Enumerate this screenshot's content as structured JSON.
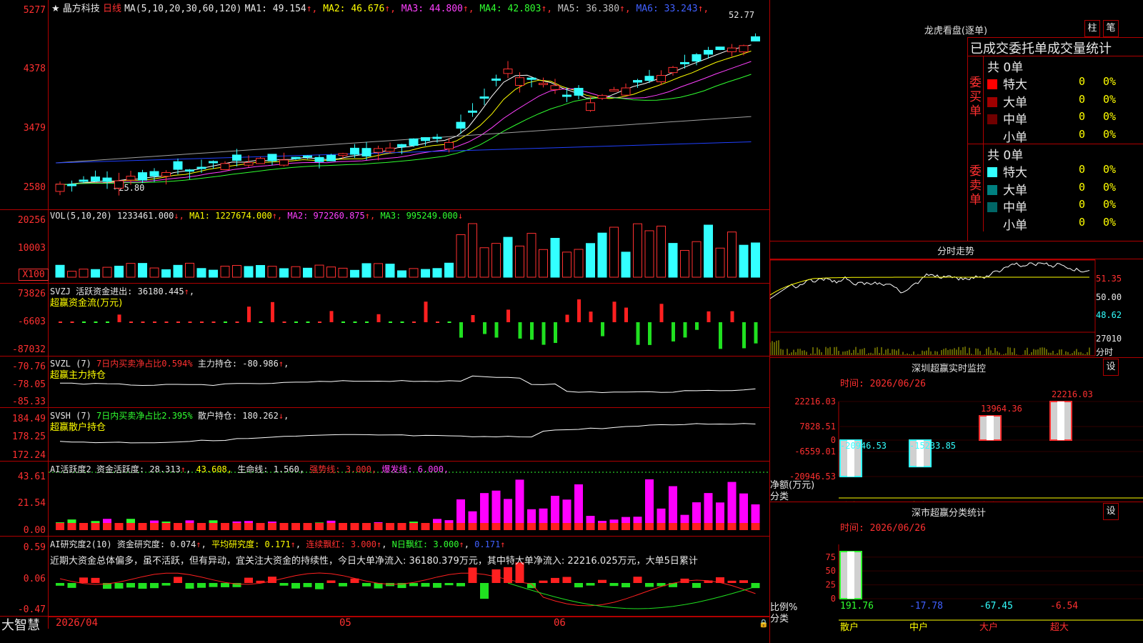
{
  "header": {
    "stock_name": "晶方科技",
    "period": "日线",
    "ma_label": "MA(5,10,20,30,60,120)",
    "ma": [
      {
        "label": "MA1:",
        "value": "49.154",
        "color": "#e8e8e8"
      },
      {
        "label": "MA2:",
        "value": "46.676",
        "color": "#ffff00"
      },
      {
        "label": "MA3:",
        "value": "44.800",
        "color": "#ff40ff"
      },
      {
        "label": "MA4:",
        "value": "42.803",
        "color": "#30ff30"
      },
      {
        "label": "MA5:",
        "value": "36.380",
        "color": "#c0c0c0"
      },
      {
        "label": "MA6:",
        "value": "33.243",
        "color": "#4060ff"
      }
    ],
    "max_price_label": "52.77",
    "min_price_label": "←25.80"
  },
  "price_axis": [
    "5277",
    "4378",
    "3479",
    "2580"
  ],
  "vol": {
    "title": "VOL(5,10,20)",
    "value": "1233461.000",
    "ma1": "MA1: 1227674.000",
    "ma2": "MA2: 972260.875",
    "ma3": "MA3: 995249.000",
    "axis": [
      "20256",
      "10003",
      "X100"
    ]
  },
  "svzj": {
    "title": "SVZJ",
    "text": "活跃资金进出: 36180.445",
    "subtitle": "超赢资金流(万元)",
    "axis": [
      "73826",
      "-6603",
      "-87032"
    ]
  },
  "svzl": {
    "title": "SVZL (7)",
    "text1": "7日内买卖净占比0.594%",
    "text2": "主力持仓: -80.986",
    "subtitle": "超赢主力持仓",
    "axis": [
      "-70.76",
      "-78.05",
      "-85.33"
    ]
  },
  "svsh": {
    "title": "SVSH (7)",
    "text1": "7日内买卖净占比2.395%",
    "text2": "散户持仓: 180.262",
    "subtitle": "超赢散户持仓",
    "axis": [
      "184.49",
      "178.25",
      "172.24"
    ]
  },
  "ai1": {
    "title": "AI活跃度2",
    "t1": "资金活跃度: 28.313",
    "t2": "43.608,",
    "t3": "生命线: 1.560,",
    "t4": "强势线: 3.000,",
    "t5": "爆发线: 6.000,",
    "axis": [
      "43.61",
      "21.54",
      "0.00"
    ]
  },
  "ai2": {
    "title": "AI研究度2(10)",
    "t1": "资金研究度: 0.074",
    "t2": "平均研究度: 0.171",
    "t3": "连续飘红: 3.000",
    "t4": "N日飘红: 3.000",
    "t5": "0.171",
    "comment": "近期大资金总体偏多，虽不活跃，但有异动，宜关注大资金的持续性，今日大单净流入: 36180.379万元，其中特大单净流入: 22216.025万元，大单5日累计",
    "axis": [
      "0.59",
      "0.06",
      "-0.47"
    ]
  },
  "xaxis": {
    "d1": "2026/04",
    "d2": "05",
    "d3": "06"
  },
  "brand": "大智慧",
  "right": {
    "lhb_title": "龙虎看盘(逐单)",
    "btn1": "柱",
    "btn2": "笔",
    "stat_title": "已成交委托单成交量统计",
    "buy": {
      "side": "委买单",
      "total": "共 0单",
      "rows": [
        {
          "name": "特大",
          "v": "0",
          "p": "0%",
          "color": "#ff0000"
        },
        {
          "name": "大单",
          "v": "0",
          "p": "0%",
          "color": "#a00000"
        },
        {
          "name": "中单",
          "v": "0",
          "p": "0%",
          "color": "#700000"
        },
        {
          "name": "小单",
          "v": "0",
          "p": "0%",
          "color": "#000000"
        }
      ]
    },
    "sell": {
      "side": "委卖单",
      "total": "共 0单",
      "rows": [
        {
          "name": "特大",
          "v": "0",
          "p": "0%",
          "color": "#33ffff"
        },
        {
          "name": "大单",
          "v": "0",
          "p": "0%",
          "color": "#008080"
        },
        {
          "name": "中单",
          "v": "0",
          "p": "0%",
          "color": "#006666"
        },
        {
          "name": "小单",
          "v": "0",
          "p": "0%",
          "color": "#000000"
        }
      ]
    },
    "intraday_title": "分时走势",
    "intraday_axis": [
      "51.35",
      "50.00",
      "48.62",
      "27010",
      "分时"
    ],
    "sz_title": "深圳超赢实时监控",
    "sz_settings": "设",
    "sz_time": "时间: 2026/06/26",
    "sz_axis": [
      "22216.03",
      "7828.51",
      "0",
      "-6559.01",
      "-20946.53"
    ],
    "sz_bar_labels": [
      "-20946.53",
      "-15233.85",
      "13964.36",
      "22216.03"
    ],
    "sz_ylabel": "净额(万元)",
    "sz_xlabel": "分类",
    "cats": [
      "散户",
      "中户",
      "大户",
      "超大"
    ],
    "ss_title": "深市超赢分类统计",
    "ss_settings": "设",
    "ss_time": "时间: 2026/06/26",
    "ss_axis": [
      "75",
      "50",
      "25",
      "0"
    ],
    "ss_values": [
      "191.76",
      "-17.78",
      "-67.45",
      "-6.54"
    ],
    "ss_ylabel": "比例%",
    "ss_xlabel": "分类"
  }
}
